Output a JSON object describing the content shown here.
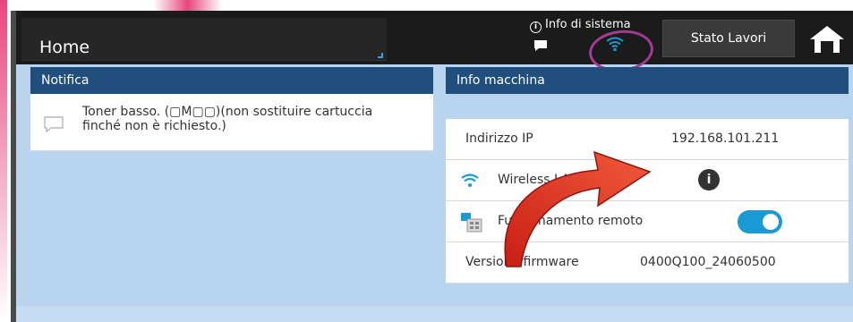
{
  "topbar": {
    "home_label": "Home",
    "system_info_label": "Info di sistema",
    "jobs_button_label": "Stato Lavori"
  },
  "notification_panel": {
    "title": "Notifica",
    "items": [
      {
        "text": "Toner basso. (▢M▢▢)(non sostituire cartuccia finché non è richiesto.)"
      }
    ]
  },
  "machine_info_panel": {
    "title": "Info macchina",
    "ip_label": "Indirizzo IP",
    "ip_value": "192.168.101.211",
    "wifi_label": "Wireless LAN",
    "remote_label": "Funzionamento remoto",
    "remote_enabled": true,
    "firmware_label": "Versione firmware",
    "firmware_value": "0400Q100_24060500"
  },
  "colors": {
    "accent": "#1a9ad4",
    "header": "#204f7d",
    "highlight_ring": "#a23b93",
    "annotation_arrow": "#d9261c"
  }
}
